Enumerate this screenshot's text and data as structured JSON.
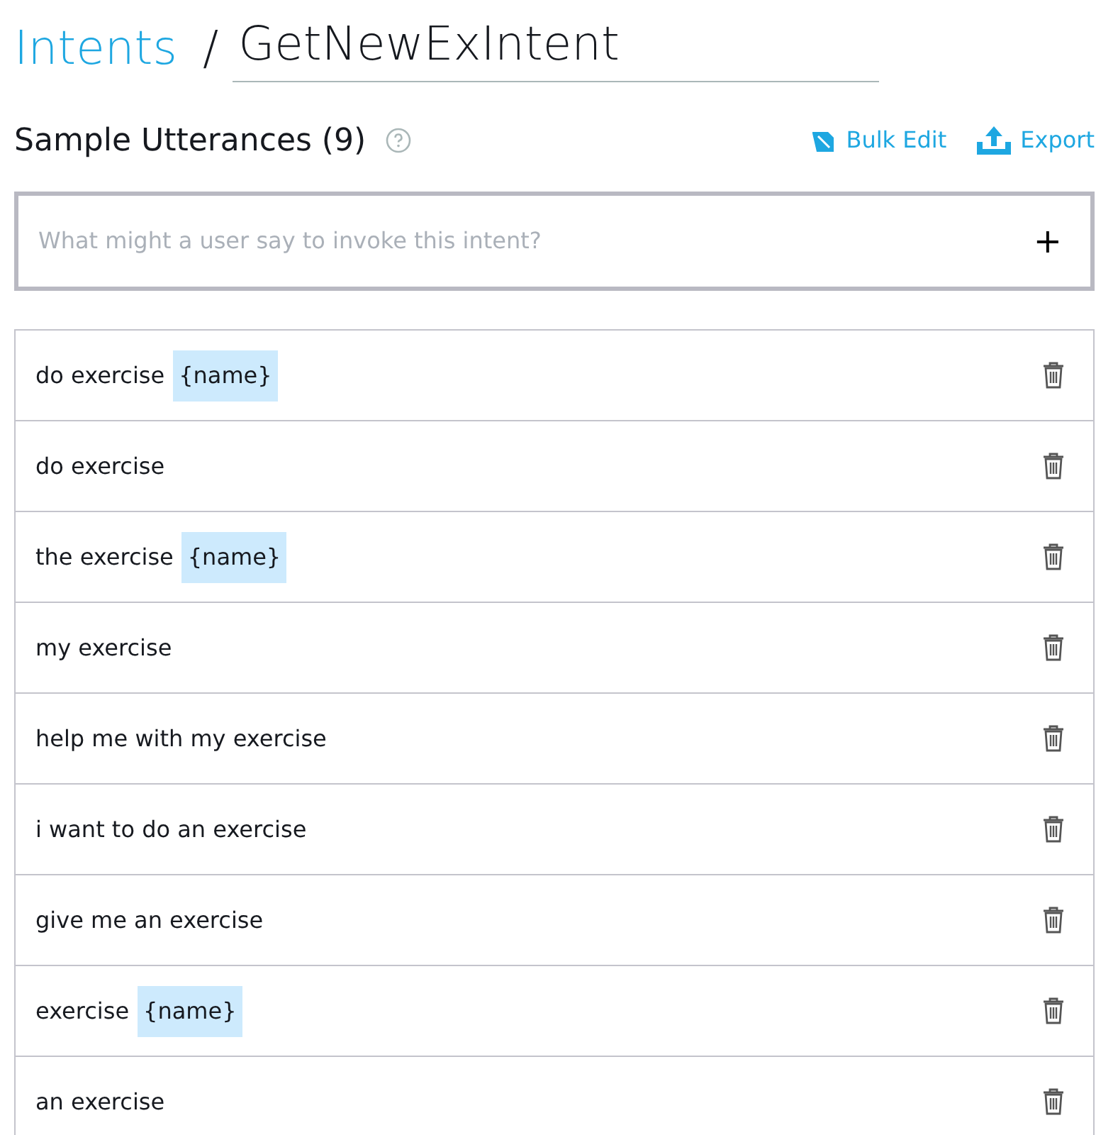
{
  "breadcrumb": {
    "parent": "Intents",
    "separator": "/",
    "title": "GetNewExIntent"
  },
  "section": {
    "title": "Sample Utterances (9)",
    "actions": [
      "Bulk Edit",
      "Export"
    ]
  },
  "utterance_input": {
    "placeholder": "What might a user say to invoke this intent?",
    "add_button": "+"
  },
  "utterances": [
    {
      "parts": [
        {
          "kind": "text",
          "text": "do exercise"
        },
        {
          "kind": "slot",
          "text": "{name}"
        }
      ]
    },
    {
      "parts": [
        {
          "kind": "text",
          "text": "do exercise"
        }
      ]
    },
    {
      "parts": [
        {
          "kind": "text",
          "text": "the exercise"
        },
        {
          "kind": "slot",
          "text": "{name}"
        }
      ]
    },
    {
      "parts": [
        {
          "kind": "text",
          "text": "my exercise"
        }
      ]
    },
    {
      "parts": [
        {
          "kind": "text",
          "text": "help me with my exercise"
        }
      ]
    },
    {
      "parts": [
        {
          "kind": "text",
          "text": "i want to do an exercise"
        }
      ]
    },
    {
      "parts": [
        {
          "kind": "text",
          "text": "give me an exercise"
        }
      ]
    },
    {
      "parts": [
        {
          "kind": "text",
          "text": "exercise"
        },
        {
          "kind": "slot",
          "text": "{name}"
        }
      ]
    },
    {
      "parts": [
        {
          "kind": "text",
          "text": "an exercise"
        }
      ]
    }
  ]
}
